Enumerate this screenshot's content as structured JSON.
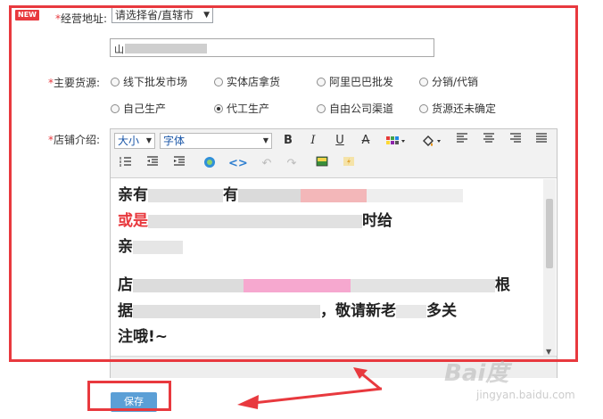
{
  "badge": "NEW",
  "address": {
    "label": "经营地址:",
    "province_selected": "请选择省/直辖市",
    "street_value": "山"
  },
  "source": {
    "label": "主要货源:",
    "options": [
      {
        "label": "线下批发市场",
        "checked": false
      },
      {
        "label": "实体店拿货",
        "checked": false
      },
      {
        "label": "阿里巴巴批发",
        "checked": false
      },
      {
        "label": "分销/代销",
        "checked": false
      },
      {
        "label": "自己生产",
        "checked": false
      },
      {
        "label": "代工生产",
        "checked": true
      },
      {
        "label": "自由公司渠道",
        "checked": false
      },
      {
        "label": "货源还未确定",
        "checked": false
      }
    ]
  },
  "intro": {
    "label": "店铺介绍:",
    "toolbar": {
      "size_label": "大小",
      "font_label": "字体"
    },
    "paragraph1": {
      "part1": "亲有",
      "part2": "有",
      "red1": "或",
      "red2": "是",
      "part3": "时给",
      "part4": "亲"
    },
    "paragraph2": {
      "part1": "店",
      "part2": "根",
      "part3": "据",
      "part4": "，敬请新老",
      "part5": "多关",
      "part6": "注哦!~"
    }
  },
  "save_label": "保存",
  "watermark": {
    "main": "Bai度",
    "sub": "jingyan.baidu.com"
  },
  "colors": {
    "highlight_frame": "#e8393e",
    "save_button": "#5b9fd6",
    "required_mark": "#e8393e"
  }
}
